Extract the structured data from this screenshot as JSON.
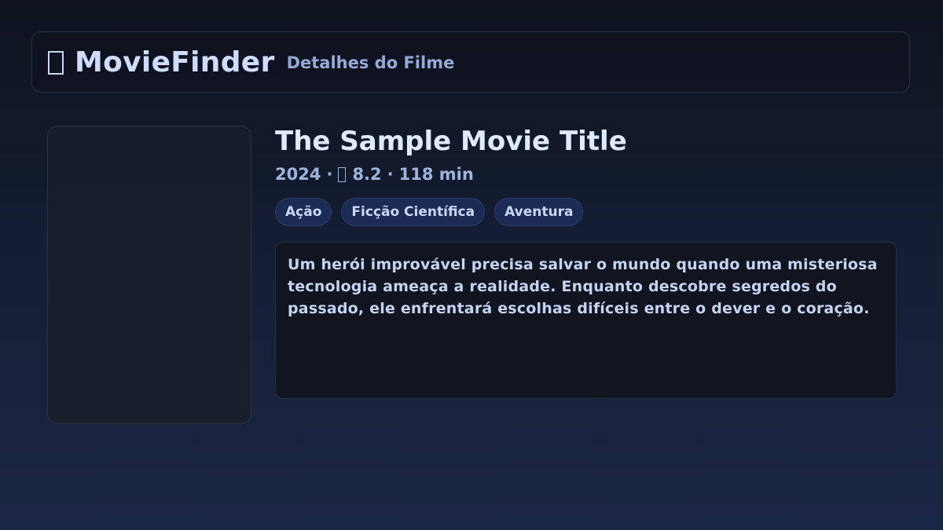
{
  "header": {
    "logo_icon": "film-icon",
    "brand": "MovieFinder",
    "subtitle": "Detalhes do Filme"
  },
  "movie": {
    "title": "The Sample Movie Title",
    "year": "2024",
    "rating_icon": "star-icon",
    "rating": "8.2",
    "duration": "118 min",
    "separator": "·",
    "genres": [
      "Ação",
      "Ficção Científica",
      "Aventura"
    ],
    "synopsis": "Um herói improvável precisa salvar o mundo quando uma misteriosa tecnologia ameaça a realidade. Enquanto descobre segredos do passado, ele enfrentará escolhas difíceis entre o dever e o coração."
  },
  "colors": {
    "background_top": "#0e131d",
    "background_bottom": "#1a2744",
    "accent_text": "#cfdcff",
    "muted_text": "#9fb4dc",
    "tag_background": "#1b2b53"
  }
}
